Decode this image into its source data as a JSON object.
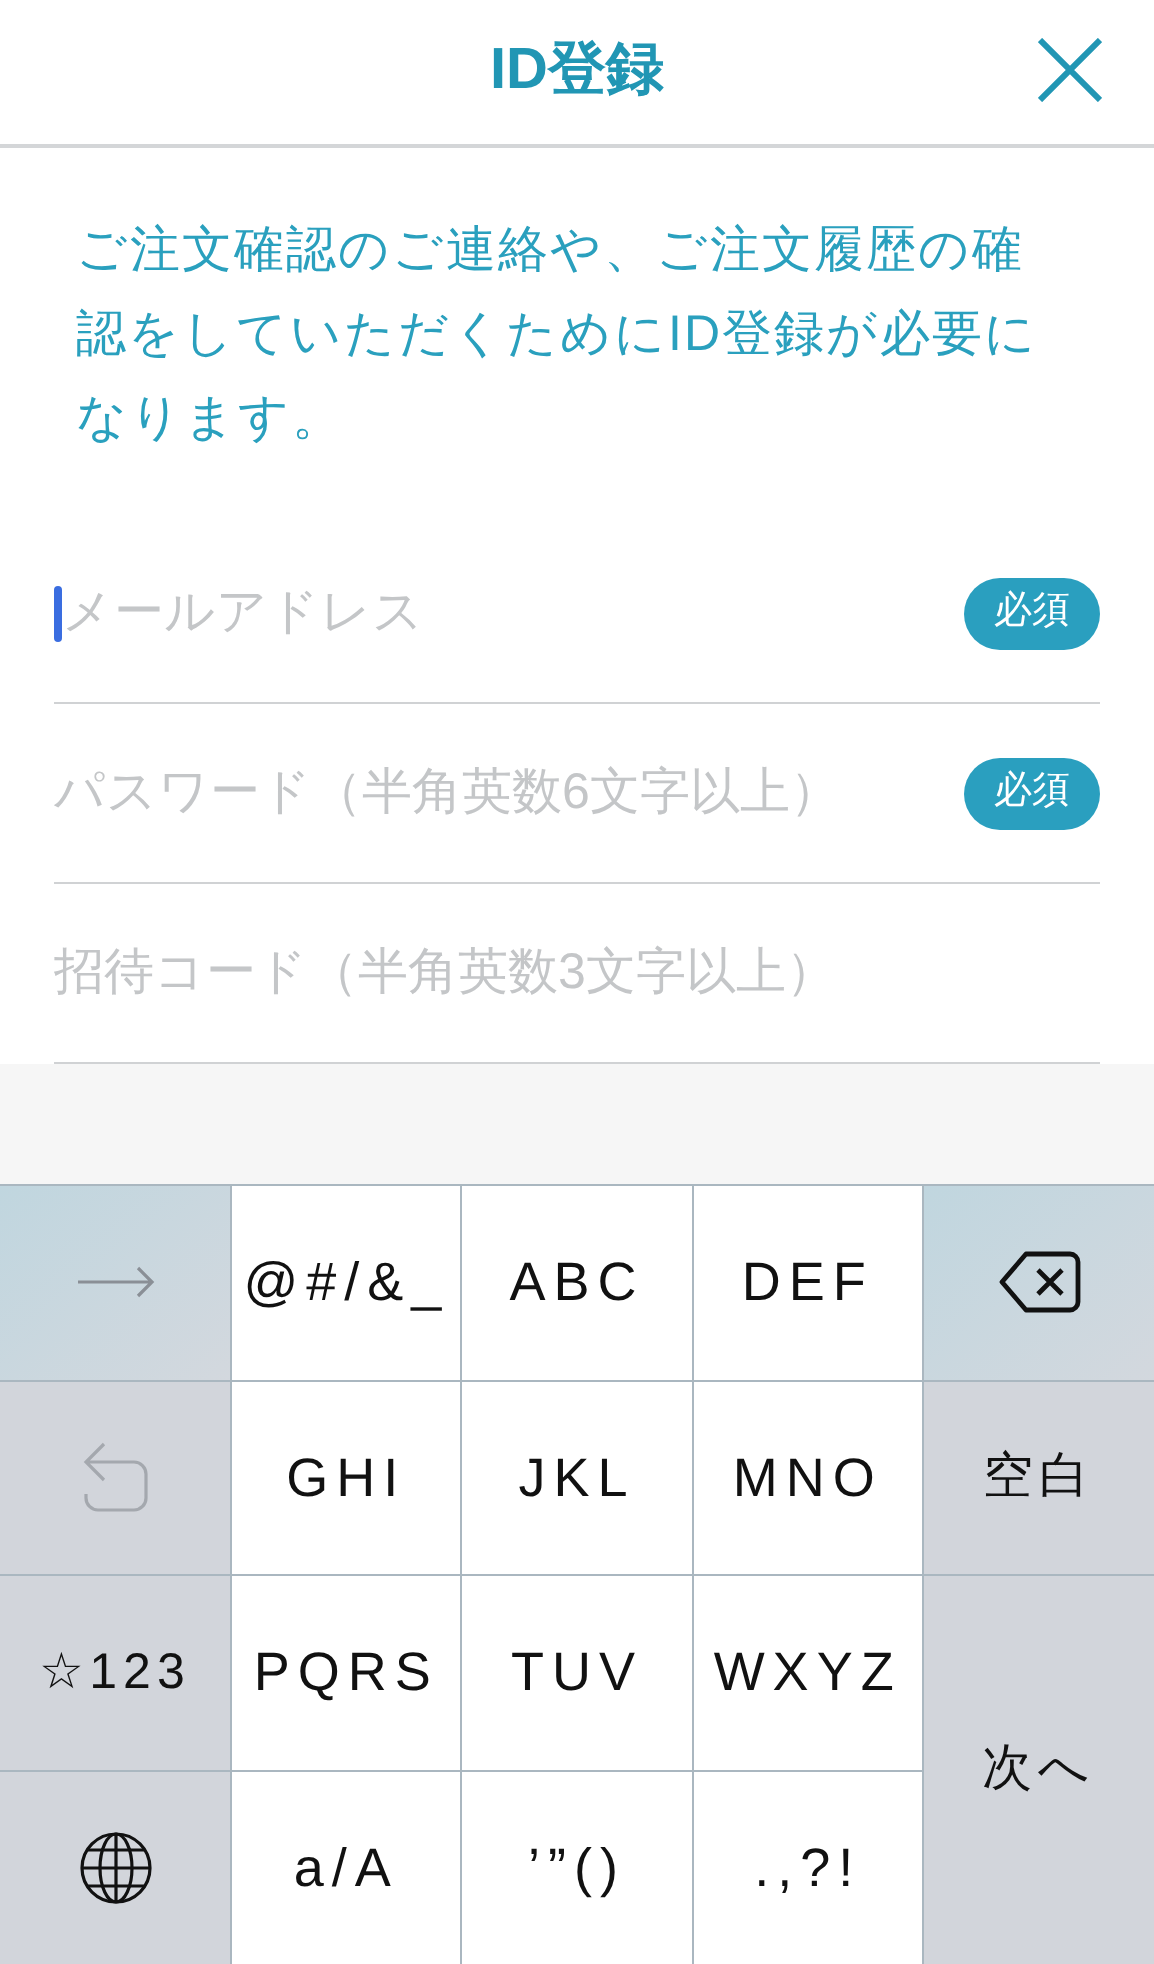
{
  "header": {
    "title": "ID登録"
  },
  "intro": "ご注文確認のご連絡や、ご注文履歴の確認をしていただくためにID登録が必要になります。",
  "fields": [
    {
      "placeholder": "メールアドレス",
      "focused": true,
      "badge": "必須"
    },
    {
      "placeholder": "パスワード（半角英数6文字以上）",
      "focused": false,
      "badge": "必須"
    },
    {
      "placeholder": "招待コード（半角英数3文字以上）",
      "focused": false
    }
  ],
  "keyboard": {
    "keys": [
      {
        "kind": "arrow"
      },
      {
        "kind": "char",
        "label": "@#/&_"
      },
      {
        "kind": "char",
        "label": "ABC"
      },
      {
        "kind": "char",
        "label": "DEF"
      },
      {
        "kind": "delete"
      },
      {
        "kind": "undo"
      },
      {
        "kind": "char",
        "label": "GHI"
      },
      {
        "kind": "char",
        "label": "JKL"
      },
      {
        "kind": "char",
        "label": "MNO"
      },
      {
        "kind": "space",
        "label": "空白"
      },
      {
        "kind": "mode",
        "label": "☆123"
      },
      {
        "kind": "char",
        "label": "PQRS"
      },
      {
        "kind": "char",
        "label": "TUV"
      },
      {
        "kind": "char",
        "label": "WXYZ"
      },
      {
        "kind": "next",
        "label": "次へ"
      },
      {
        "kind": "globe"
      },
      {
        "kind": "char",
        "label": "a/A"
      },
      {
        "kind": "char",
        "label": "’”()"
      },
      {
        "kind": "char",
        "label": ".,?!"
      }
    ]
  }
}
